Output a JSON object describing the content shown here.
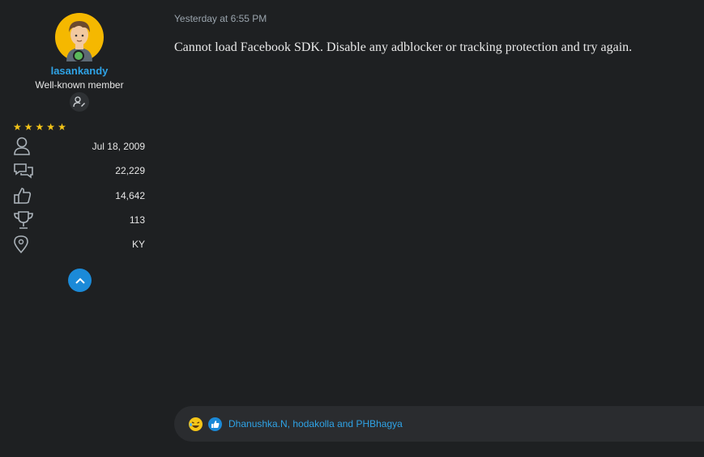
{
  "user": {
    "name": "lasankandy",
    "title": "Well-known member",
    "rating_stars": 5,
    "stats": [
      {
        "icon": "user-icon",
        "value": "Jul 18, 2009"
      },
      {
        "icon": "messages-icon",
        "value": "22,229"
      },
      {
        "icon": "thumbs-up-icon",
        "value": "14,642"
      },
      {
        "icon": "trophy-icon",
        "value": "113"
      },
      {
        "icon": "location-pin-icon",
        "value": "KY"
      }
    ]
  },
  "post": {
    "timestamp": "Yesterday at 6:55 PM",
    "body": "Cannot load Facebook SDK. Disable any adblocker or tracking protection and try again."
  },
  "reactions": {
    "icons": [
      "laughing-emoji-icon",
      "like-reaction-icon"
    ],
    "users_text": "Dhanushka.N, hodakolla and PHBhagya"
  },
  "colors": {
    "accent": "#2fa3e6",
    "star": "#f5c518",
    "online": "#5bb85b",
    "background": "#1e2022"
  }
}
